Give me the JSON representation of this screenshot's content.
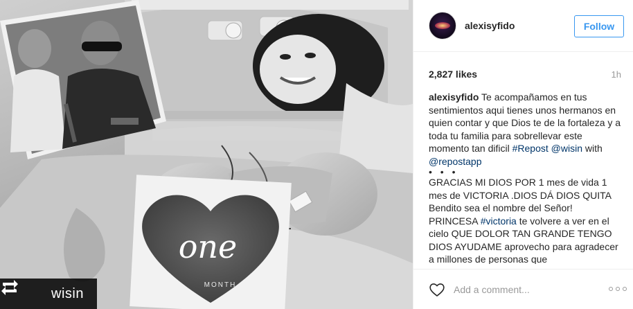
{
  "photo": {
    "repost_user": "wisin",
    "heart_text": "one",
    "heart_subtext": "MONTH"
  },
  "header": {
    "username": "alexisyfido",
    "follow_label": "Follow"
  },
  "meta": {
    "likes": "2,827 likes",
    "time": "1h"
  },
  "caption": {
    "username": "alexisyfido",
    "text1": " Te acompañamos en tus sentimientos aqui tienes unos hermanos en quien contar y que Dios te de la fortaleza y a toda tu familia para sobrellevar este momento tan dificil ",
    "hashtag1": "#Repost",
    "mention1": "@wisin",
    "with_text": " with ",
    "mention2": "@repostapp",
    "dots": "• • •",
    "text2": "GRACIAS MI DIOS POR 1 mes de vida 1 mes de VICTORIA .DIOS DÁ DIOS QUITA Bendito sea el nombre del Señor! PRINCESA ",
    "hashtag2": "#victoria",
    "text3": " te volvere a ver en el cielo QUE DOLOR TAN GRANDE TENGO DIOS AYUDAME aprovecho para agradecer a millones de personas que"
  },
  "comment": {
    "placeholder": "Add a comment..."
  },
  "icons": {
    "like": "heart-icon",
    "more": "more-options-icon",
    "repost": "repost-icon",
    "avatar": "avatar"
  },
  "colors": {
    "link": "#003569",
    "follow": "#3897f0",
    "muted": "#999999"
  }
}
